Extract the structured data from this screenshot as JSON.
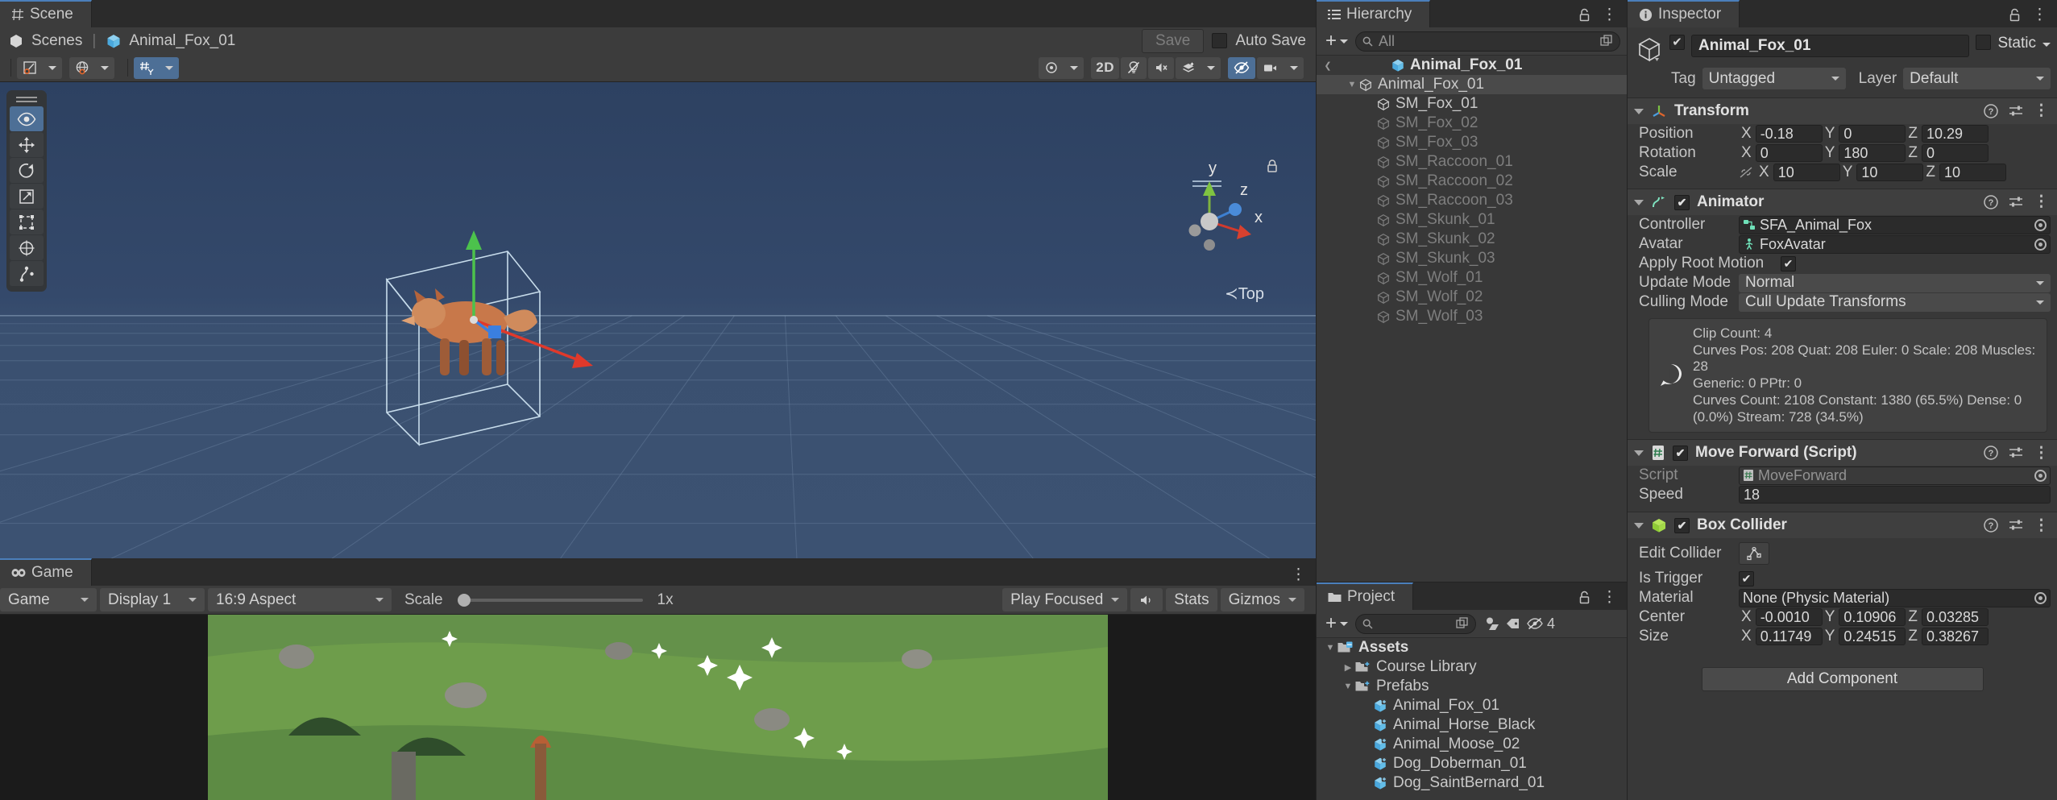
{
  "scene": {
    "tab_label": "Scene",
    "breadcrumb": {
      "root": "Scenes",
      "separator": "|",
      "current": "Animal_Fox_01"
    },
    "save_label": "Save",
    "auto_save_label": "Auto Save",
    "auto_save_checked": false,
    "toolbar": {
      "tool_move_label": "move-gizmo",
      "handle_pos_label": "pivot",
      "handle_rot_label": "global",
      "view_2d_label": "2D",
      "grid_label": "grid",
      "audio_label": "audio",
      "fx_label": "effects",
      "vis_label": "visibility",
      "camera_label": "camera"
    },
    "overlay_tools": [
      "view-tool",
      "move-tool",
      "rotate-tool",
      "scale-tool",
      "rect-tool",
      "transform-tool",
      "custom-tool"
    ],
    "gizmo": {
      "x_label": "x",
      "y_label": "y",
      "z_label": "z",
      "persp_label": "≺Top"
    }
  },
  "game": {
    "tab_label": "Game",
    "display_mode": "Game",
    "display": "Display 1",
    "aspect": "16:9 Aspect",
    "scale_label": "Scale",
    "scale_value": "1x",
    "play_focused": "Play Focused",
    "stats_label": "Stats",
    "gizmos_label": "Gizmos"
  },
  "hierarchy": {
    "tab_label": "Hierarchy",
    "search_placeholder": "All",
    "scene_root": "Animal_Fox_01",
    "items": [
      {
        "label": "Animal_Fox_01",
        "depth": 1,
        "expanded": true,
        "selected": true,
        "dim": false
      },
      {
        "label": "SM_Fox_01",
        "depth": 2,
        "expanded": false,
        "selected": false,
        "dim": false
      },
      {
        "label": "SM_Fox_02",
        "depth": 2,
        "expanded": false,
        "selected": false,
        "dim": true
      },
      {
        "label": "SM_Fox_03",
        "depth": 2,
        "expanded": false,
        "selected": false,
        "dim": true
      },
      {
        "label": "SM_Raccoon_01",
        "depth": 2,
        "expanded": false,
        "selected": false,
        "dim": true
      },
      {
        "label": "SM_Raccoon_02",
        "depth": 2,
        "expanded": false,
        "selected": false,
        "dim": true
      },
      {
        "label": "SM_Raccoon_03",
        "depth": 2,
        "expanded": false,
        "selected": false,
        "dim": true
      },
      {
        "label": "SM_Skunk_01",
        "depth": 2,
        "expanded": false,
        "selected": false,
        "dim": true
      },
      {
        "label": "SM_Skunk_02",
        "depth": 2,
        "expanded": false,
        "selected": false,
        "dim": true
      },
      {
        "label": "SM_Skunk_03",
        "depth": 2,
        "expanded": false,
        "selected": false,
        "dim": true
      },
      {
        "label": "SM_Wolf_01",
        "depth": 2,
        "expanded": false,
        "selected": false,
        "dim": true
      },
      {
        "label": "SM_Wolf_02",
        "depth": 2,
        "expanded": false,
        "selected": false,
        "dim": true
      },
      {
        "label": "SM_Wolf_03",
        "depth": 2,
        "expanded": false,
        "selected": false,
        "dim": true
      }
    ]
  },
  "project": {
    "tab_label": "Project",
    "search_placeholder": "",
    "hidden_count": "4",
    "items": [
      {
        "label": "Assets",
        "depth": 0,
        "tri": "▼",
        "icon": "folder-assets",
        "bold": true
      },
      {
        "label": "Course Library",
        "depth": 1,
        "tri": "▶",
        "icon": "folder",
        "bold": false
      },
      {
        "label": "Prefabs",
        "depth": 1,
        "tri": "▼",
        "icon": "folder",
        "bold": false
      },
      {
        "label": "Animal_Fox_01",
        "depth": 2,
        "tri": "",
        "icon": "prefab",
        "bold": false
      },
      {
        "label": "Animal_Horse_Black",
        "depth": 2,
        "tri": "",
        "icon": "prefab",
        "bold": false
      },
      {
        "label": "Animal_Moose_02",
        "depth": 2,
        "tri": "",
        "icon": "prefab",
        "bold": false
      },
      {
        "label": "Dog_Doberman_01",
        "depth": 2,
        "tri": "",
        "icon": "prefab",
        "bold": false
      },
      {
        "label": "Dog_SaintBernard_01",
        "depth": 2,
        "tri": "",
        "icon": "prefab",
        "bold": false
      }
    ]
  },
  "inspector": {
    "tab_label": "Inspector",
    "object_name": "Animal_Fox_01",
    "object_enabled": true,
    "static_label": "Static",
    "static_checked": false,
    "tag_label": "Tag",
    "tag_value": "Untagged",
    "layer_label": "Layer",
    "layer_value": "Default",
    "transform": {
      "title": "Transform",
      "position_label": "Position",
      "position": {
        "x": "-0.18",
        "y": "0",
        "z": "10.29"
      },
      "rotation_label": "Rotation",
      "rotation": {
        "x": "0",
        "y": "180",
        "z": "0"
      },
      "scale_label": "Scale",
      "scale": {
        "x": "10",
        "y": "10",
        "z": "10"
      }
    },
    "animator": {
      "title": "Animator",
      "enabled": true,
      "controller_label": "Controller",
      "controller_value": "SFA_Animal_Fox",
      "avatar_label": "Avatar",
      "avatar_value": "FoxAvatar",
      "apply_root_motion_label": "Apply Root Motion",
      "apply_root_motion": true,
      "update_mode_label": "Update Mode",
      "update_mode_value": "Normal",
      "culling_mode_label": "Culling Mode",
      "culling_mode_value": "Cull Update Transforms",
      "info_line_1": "Clip Count: 4",
      "info_line_2": "Curves Pos: 208 Quat: 208 Euler: 0 Scale: 208 Muscles: 28",
      "info_line_3": "Generic: 0 PPtr: 0",
      "info_line_4": "Curves Count: 2108 Constant: 1380 (65.5%) Dense: 0",
      "info_line_5": "(0.0%) Stream: 728 (34.5%)"
    },
    "move_forward": {
      "title": "Move Forward (Script)",
      "enabled": true,
      "script_label": "Script",
      "script_value": "MoveForward",
      "speed_label": "Speed",
      "speed_value": "18"
    },
    "box_collider": {
      "title": "Box Collider",
      "enabled": true,
      "edit_collider_label": "Edit Collider",
      "is_trigger_label": "Is Trigger",
      "is_trigger": true,
      "material_label": "Material",
      "material_value": "None (Physic Material)",
      "center_label": "Center",
      "center": {
        "x": "-0.0010",
        "y": "0.10906",
        "z": "0.03285"
      },
      "size_label": "Size",
      "size": {
        "x": "0.11749",
        "y": "0.24515",
        "z": "0.38267"
      }
    },
    "add_component_label": "Add Component"
  },
  "colors": {
    "accent_blue": "#4d6f96",
    "tab_underline": "#4b7fbb",
    "panel_bg": "#383838",
    "scene_sky": "#34496b",
    "gizmo_green": "#6cc04a",
    "gizmo_red": "#d14a3c",
    "prefab_blue": "#5bb5e8"
  }
}
